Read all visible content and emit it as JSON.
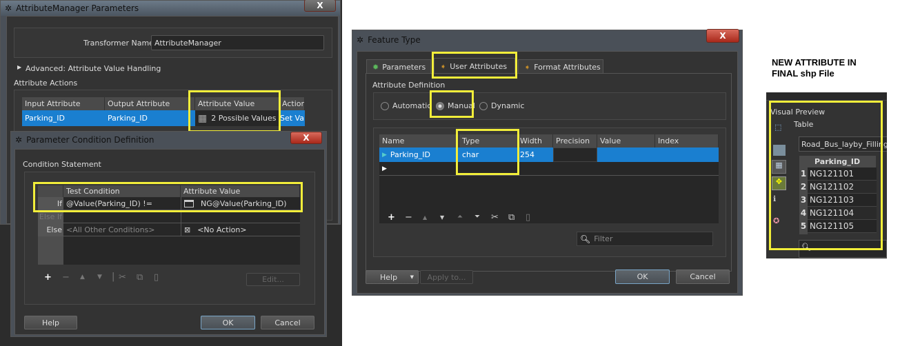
{
  "attribute_manager": {
    "title": "AttributeManager Parameters",
    "transformer_name_label": "Transformer Name:",
    "transformer_name_value": "AttributeManager",
    "advanced_label": "Advanced: Attribute Value Handling",
    "actions_label": "Attribute Actions",
    "columns": [
      "Input Attribute",
      "Output Attribute",
      "Attribute Value",
      "Action"
    ],
    "row": [
      "Parking_ID",
      "Parking_ID",
      "2 Possible Values",
      "Set Value"
    ],
    "close": "X"
  },
  "condition_dialog": {
    "title": "Parameter Condition Definition",
    "section_label": "Condition Statement",
    "columns": [
      "Test Condition",
      "Attribute Value"
    ],
    "rows": [
      {
        "label": "If",
        "condition": "@Value(Parking_ID) !=",
        "value": "NG@Value(Parking_ID)"
      },
      {
        "label": "Else If",
        "condition": "",
        "value": ""
      },
      {
        "label": "Else",
        "condition": "<All Other Conditions>",
        "value": "<No Action>"
      }
    ],
    "edit_button": "Edit...",
    "help_button": "Help",
    "ok_button": "OK",
    "cancel_button": "Cancel",
    "close": "X"
  },
  "feature_type": {
    "title": "Feature Type",
    "tabs": [
      "Parameters",
      "User Attributes",
      "Format Attributes"
    ],
    "active_tab": "User Attributes",
    "section_label": "Attribute Definition",
    "radios": [
      "Automatic",
      "Manual",
      "Dynamic"
    ],
    "selected_radio": "Manual",
    "columns": [
      "Name",
      "Type",
      "Width",
      "Precision",
      "Value",
      "Index"
    ],
    "row": [
      "Parking_ID",
      "char",
      "254",
      "",
      "",
      ""
    ],
    "filter_placeholder": "Filter",
    "help_button": "Help",
    "apply_button": "Apply to...",
    "ok_button": "OK",
    "cancel_button": "Cancel",
    "close": "X"
  },
  "preview": {
    "note_line1": "NEW ATTRIBUTE IN",
    "note_line2": "FINAL shp File",
    "title": "Visual Preview",
    "table_label": "Table",
    "dataset": "Road_Bus_layby_Filling",
    "column": "Parking_ID",
    "rows": [
      {
        "n": "1",
        "v": "NG121101"
      },
      {
        "n": "2",
        "v": "NG121102"
      },
      {
        "n": "3",
        "v": "NG121103"
      },
      {
        "n": "4",
        "v": "NG121104"
      },
      {
        "n": "5",
        "v": "NG121105"
      }
    ]
  },
  "colors": {
    "highlight": "#f2ee3a",
    "selection": "#1a7fd0"
  }
}
